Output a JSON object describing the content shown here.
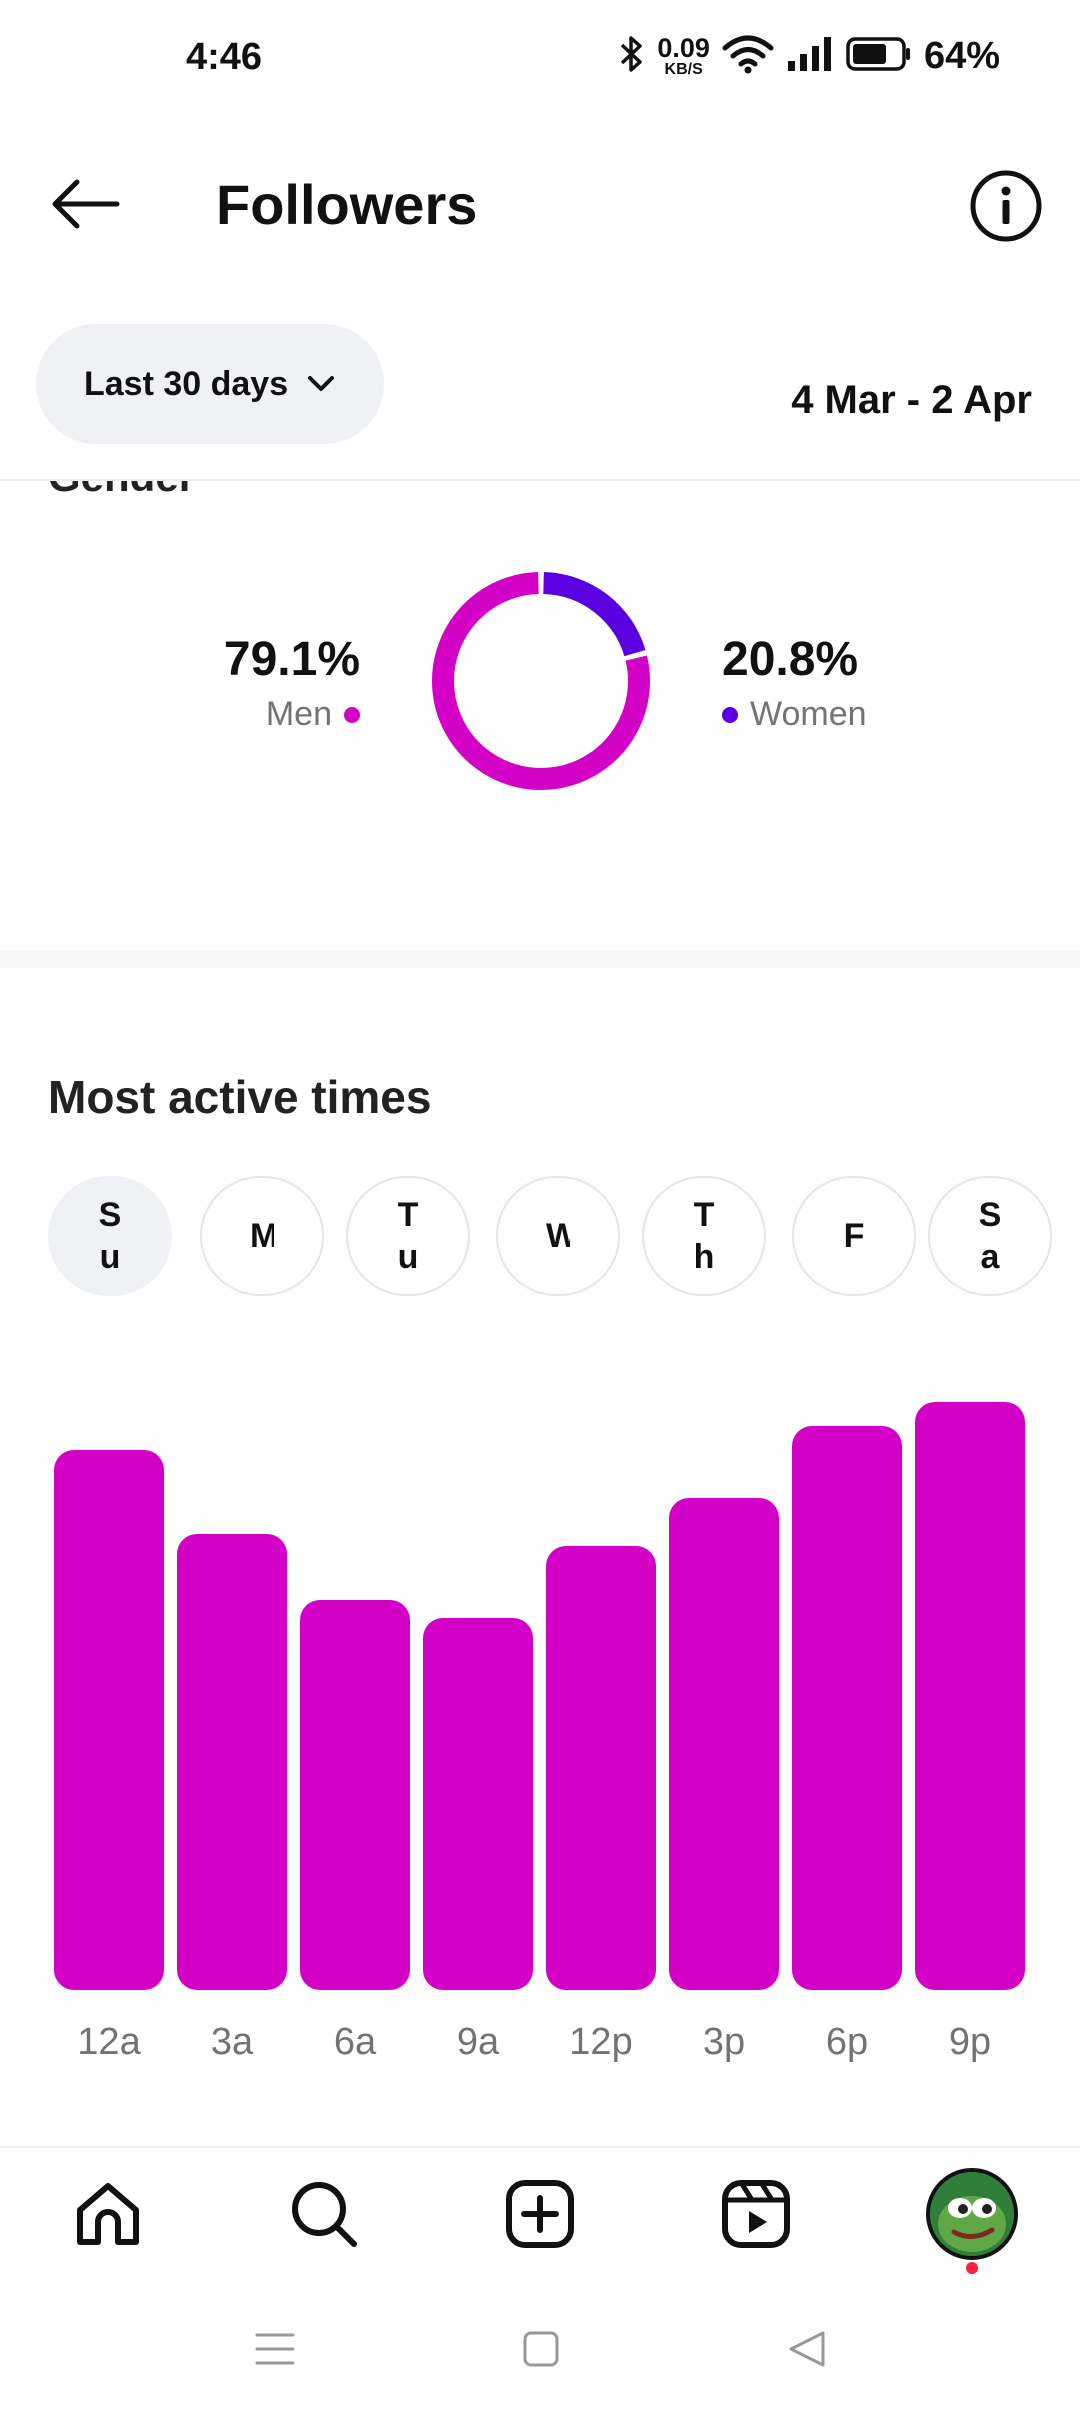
{
  "status_bar": {
    "time": "4:46",
    "net_speed_value": "0.09",
    "net_speed_unit": "KB/S",
    "battery": "64%"
  },
  "header": {
    "title": "Followers"
  },
  "range": {
    "selector_label": "Last 30 days",
    "date_range": "4 Mar - 2 Apr"
  },
  "gender": {
    "heading": "Gender",
    "men_value": "79.1%",
    "men_label": "Men",
    "women_value": "20.8%",
    "women_label": "Women"
  },
  "most_active": {
    "title": "Most active times",
    "days": [
      "Su",
      "M",
      "Tu",
      "W",
      "Th",
      "F",
      "Sa"
    ],
    "selected_day": "Su"
  },
  "colors": {
    "men": "#d300c5",
    "women": "#5b00e0",
    "bar": "#d300c5",
    "axis_label": "#737373"
  },
  "chart_data": {
    "type": "bar",
    "categories": [
      "12a",
      "3a",
      "6a",
      "9a",
      "12p",
      "3p",
      "6p",
      "9p"
    ],
    "values": [
      90,
      76,
      65,
      62,
      74,
      82,
      94,
      98
    ],
    "ylim": [
      0,
      100
    ],
    "grid": false
  },
  "nav": {
    "items": [
      "home-icon",
      "search-icon",
      "create-icon",
      "reels-icon",
      "profile-avatar"
    ]
  }
}
